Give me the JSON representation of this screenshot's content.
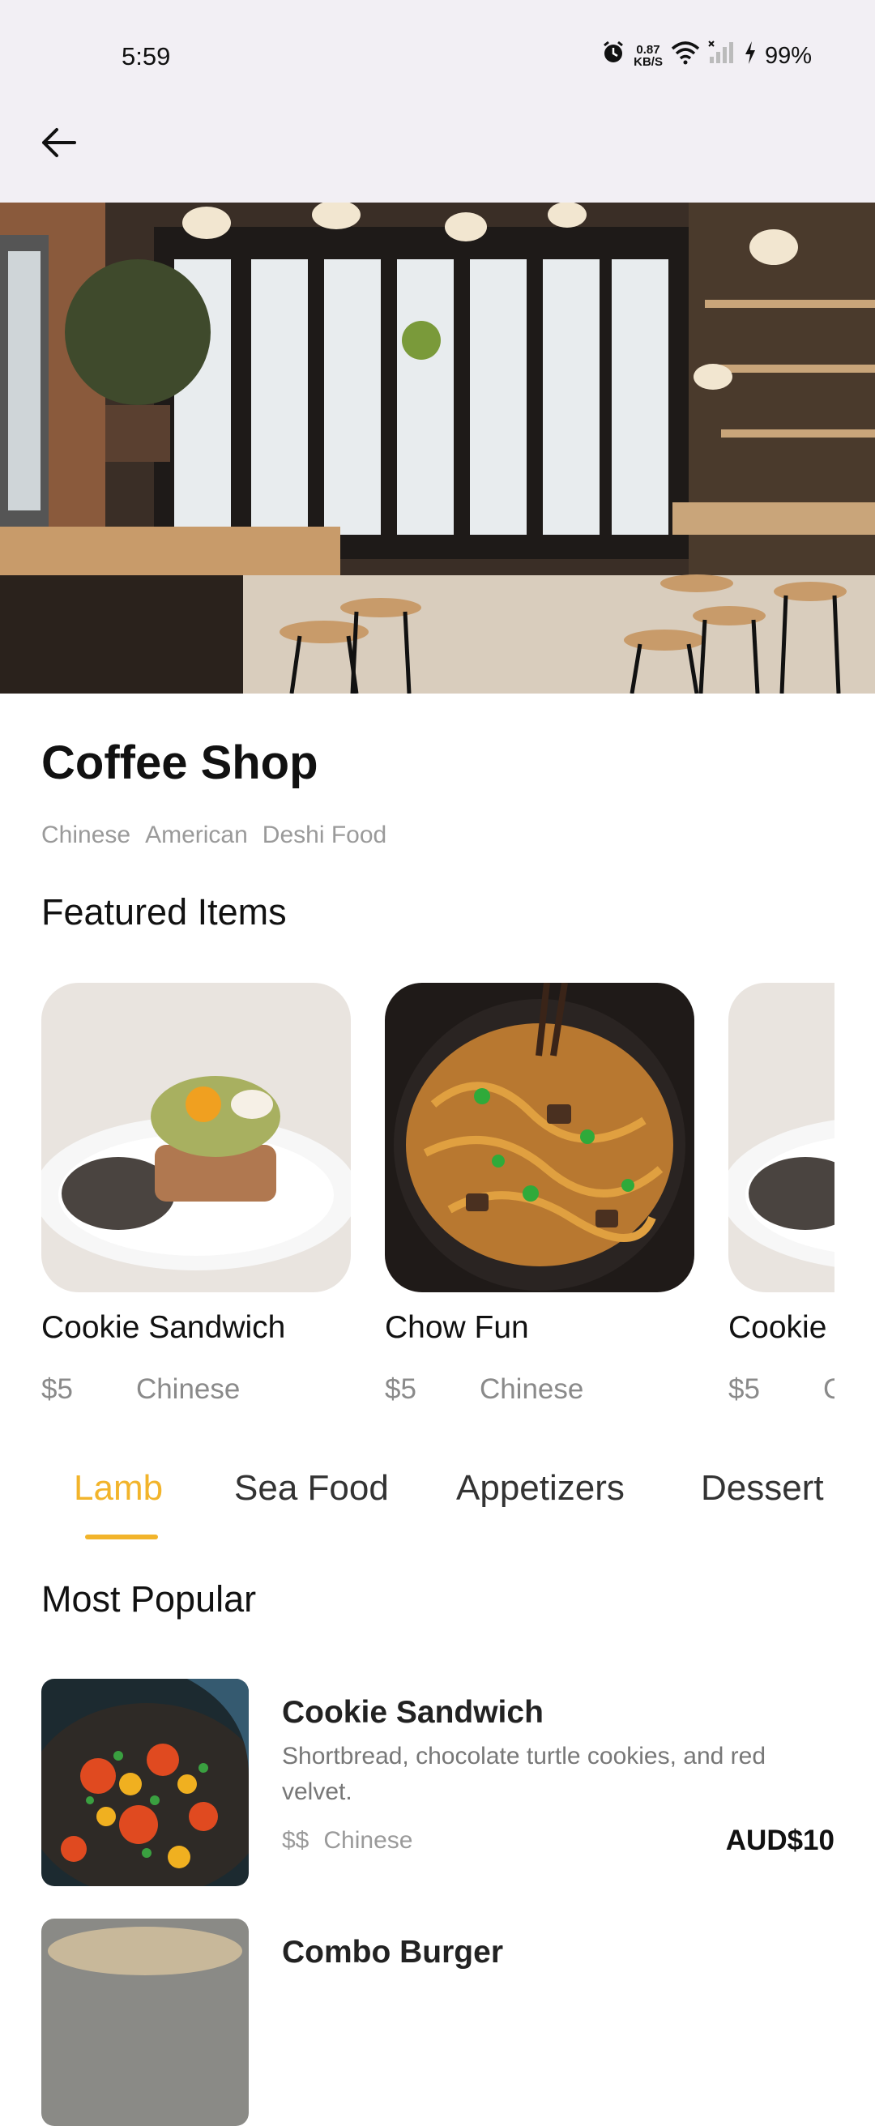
{
  "status_bar": {
    "time": "5:59",
    "speed_value": "0.87",
    "speed_unit": "KB/S",
    "battery": "99%"
  },
  "shop": {
    "name": "Coffee Shop",
    "cuisines": [
      "Chinese",
      "American",
      "Deshi Food"
    ]
  },
  "featured": {
    "heading": "Featured Items",
    "items": [
      {
        "name": "Cookie Sandwich",
        "price": "$5",
        "cuisine": "Chinese"
      },
      {
        "name": "Chow Fun",
        "price": "$5",
        "cuisine": "Chinese"
      },
      {
        "name": "Cookie Sandwich",
        "price": "$5",
        "cuisine": "Chinese"
      }
    ]
  },
  "tabs": {
    "items": [
      "Lamb",
      "Sea Food",
      "Appetizers",
      "Dessert"
    ],
    "active": "Lamb"
  },
  "most_popular": {
    "heading": "Most Popular",
    "items": [
      {
        "name": "Cookie Sandwich",
        "description": "Shortbread, chocolate turtle cookies, and red velvet.",
        "price_level": "$$",
        "cuisine": "Chinese",
        "price": "AUD$10"
      },
      {
        "name": "Combo Burger"
      }
    ]
  },
  "icons": {
    "back": "arrow-left-icon",
    "alarm": "alarm-icon",
    "wifi": "wifi-icon",
    "signal": "signal-icon",
    "battery": "battery-charging-icon"
  },
  "colors": {
    "accent": "#f2b42b",
    "topbar": "#f2eff4"
  }
}
